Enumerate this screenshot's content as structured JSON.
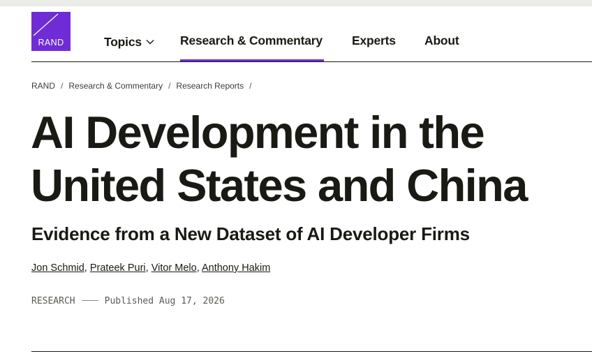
{
  "logo": {
    "text": "RAND"
  },
  "nav": {
    "items": [
      {
        "label": "Topics"
      },
      {
        "label": "Research & Commentary"
      },
      {
        "label": "Experts"
      },
      {
        "label": "About"
      }
    ],
    "active": "Research & Commentary"
  },
  "breadcrumb": {
    "items": [
      "RAND",
      "Research & Commentary",
      "Research Reports"
    ],
    "separator": "/"
  },
  "article": {
    "title": "AI Development in the United States and China",
    "subtitle": "Evidence from a New Dataset of AI Developer Firms",
    "authors": [
      "Jon Schmid",
      "Prateek Puri",
      "Vitor Melo",
      "Anthony Hakim"
    ],
    "type": "RESEARCH",
    "published": "Published Aug 17, 2026"
  },
  "colors": {
    "brand": "#6f2cd6",
    "text": "#1a1a14",
    "muted": "#5a5a54"
  }
}
